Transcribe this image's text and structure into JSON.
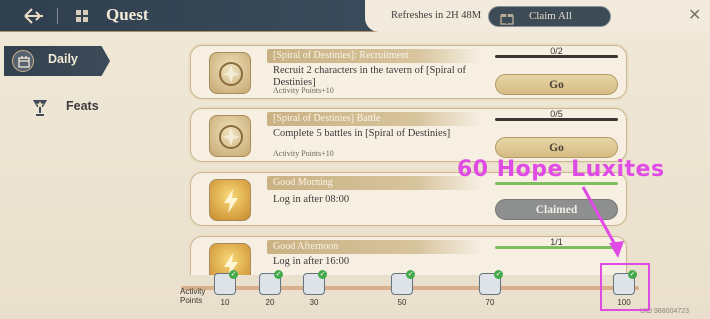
{
  "header": {
    "title": "Quest",
    "refresh_text": "Refreshes in 2H 48M",
    "claim_all_label": "Claim All",
    "close_glyph": "✕"
  },
  "sidebar": {
    "items": [
      {
        "label": "Daily",
        "icon": "calendar-icon",
        "active": true
      },
      {
        "label": "Feats",
        "icon": "trophy-icon",
        "active": false
      }
    ]
  },
  "quests": [
    {
      "title": "[Spiral of Destinies]: Recruitment",
      "description": "Recruit 2 characters in the tavern of [Spiral of Destinies]",
      "points": "Activity Points+10",
      "progress_text": "0/2",
      "progress": 0,
      "action": "Go",
      "icon": "spiral-emblem-icon"
    },
    {
      "title": "[Spiral of Destinies] Battle",
      "description": "Complete 5 battles in [Spiral of Destinies]",
      "points": "Activity Points+10",
      "progress_text": "0/5",
      "progress": 0,
      "action": "Go",
      "icon": "spiral-emblem-icon"
    },
    {
      "title": "Good Morning",
      "description": "Log in after 08:00",
      "points": "",
      "progress_text": "",
      "progress": 1,
      "action": "Claimed",
      "icon": "lightning-icon"
    },
    {
      "title": "Good Afternoon",
      "description": "Log in after 16:00",
      "points": "",
      "progress_text": "1/1",
      "progress": 1,
      "action": "",
      "icon": "lightning-icon"
    }
  ],
  "activity": {
    "label_line1": "Activity",
    "label_line2": "Points",
    "milestones": [
      "10",
      "20",
      "30",
      "50",
      "70",
      "100"
    ]
  },
  "uid": "UID 968004723",
  "annotation": {
    "text": "60 Hope Luxites",
    "color": "#e04be6"
  },
  "colors": {
    "header_bg": "#33414f",
    "accent_gold": "#d5bb84",
    "progress_green": "#7dbf5e",
    "annotation": "#e04be6"
  }
}
